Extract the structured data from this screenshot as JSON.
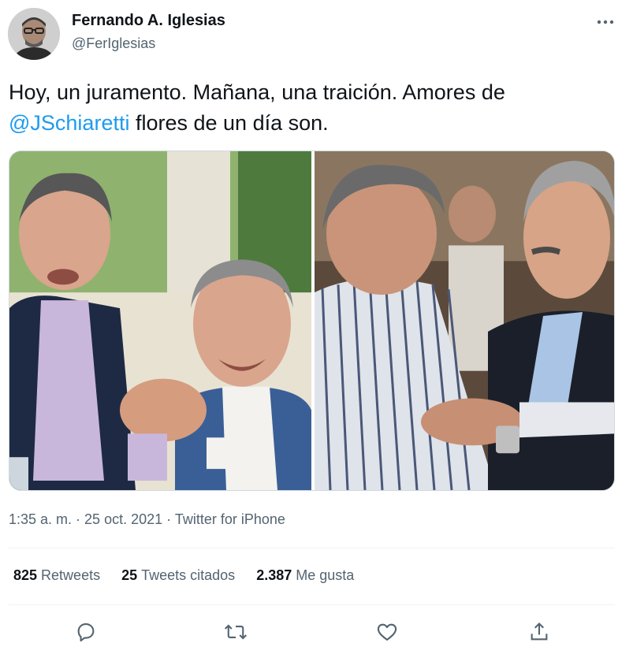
{
  "author": {
    "name": "Fernando A. Iglesias",
    "handle": "@FerIglesias",
    "avatar_icon": "profile-photo"
  },
  "tweet": {
    "text_before": "Hoy, un juramento. Mañana, una traición. Amores de ",
    "mention": "@JSchiaretti",
    "text_after": " flores de un día son.",
    "media": [
      {
        "kind": "photo"
      },
      {
        "kind": "photo"
      }
    ]
  },
  "meta": {
    "time": "1:35 a. m.",
    "separator": " · ",
    "date": "25 oct. 2021",
    "source": "Twitter for iPhone"
  },
  "stats": {
    "retweets_count": "825",
    "retweets_label": "Retweets",
    "quotes_count": "25",
    "quotes_label": "Tweets citados",
    "likes_count": "2.387",
    "likes_label": "Me gusta"
  },
  "actions": [
    {
      "icon": "reply-icon"
    },
    {
      "icon": "retweet-icon"
    },
    {
      "icon": "like-icon"
    },
    {
      "icon": "share-icon"
    }
  ],
  "colors": {
    "accent": "#1d9bf0",
    "text": "#0f1419",
    "secondary": "#536471",
    "divider": "#eff3f4"
  }
}
